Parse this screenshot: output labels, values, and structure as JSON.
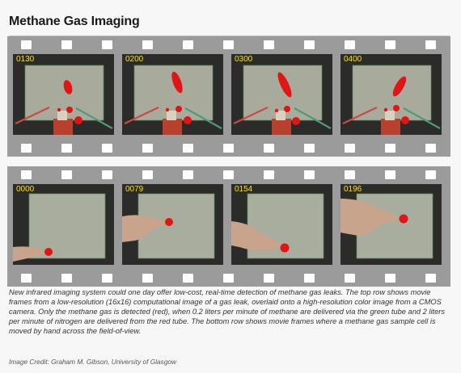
{
  "title": "Methane Gas Imaging",
  "top_frames": [
    "0130",
    "0200",
    "0300",
    "0400"
  ],
  "bottom_frames": [
    "0000",
    "0079",
    "0154",
    "0196"
  ],
  "caption": "New infrared imaging system could one day offer low-cost, real-time detection of methane gas leaks. The top row shows movie frames from a low-resolution (16x16) computational image of a gas leak, overlaid onto a high-resolution color image from a CMOS camera. Only the methane gas is detected (red), when 0.2 liters per minute of methane are delivered via the green tube and 2 liters per minute of nitrogen are delivered from the red tube. The bottom row shows movie frames where a methane gas sample cell is moved by hand across the field-of-view.",
  "credit": "Image Credit: Graham M. Gibson, University of Glasgow",
  "colors": {
    "film": "#9b9b9b",
    "frame_number": "#ffe400",
    "gas": "#e01515"
  }
}
